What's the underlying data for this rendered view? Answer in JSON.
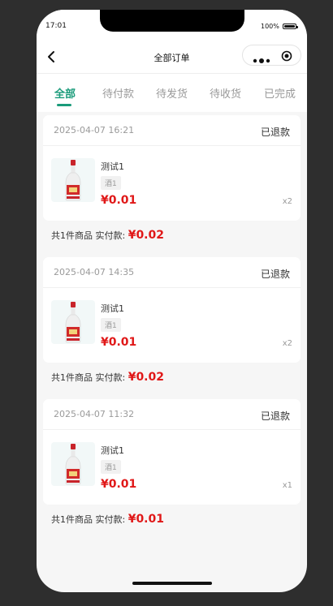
{
  "status_bar": {
    "time": "17:01",
    "battery": "100%"
  },
  "nav": {
    "title": "全部订单"
  },
  "tabs": [
    {
      "label": "全部",
      "active": true
    },
    {
      "label": "待付款",
      "active": false
    },
    {
      "label": "待发货",
      "active": false
    },
    {
      "label": "待收货",
      "active": false
    },
    {
      "label": "已完成",
      "active": false
    }
  ],
  "orders": [
    {
      "date": "2025-04-07 16:21",
      "status": "已退款",
      "product": {
        "name": "测试1",
        "tag": "酒1",
        "price": "¥0.01",
        "qty": "x2"
      },
      "summary": {
        "label": "共1件商品 实付款:",
        "amount": "¥0.02"
      }
    },
    {
      "date": "2025-04-07 14:35",
      "status": "已退款",
      "product": {
        "name": "测试1",
        "tag": "酒1",
        "price": "¥0.01",
        "qty": "x2"
      },
      "summary": {
        "label": "共1件商品 实付款:",
        "amount": "¥0.02"
      }
    },
    {
      "date": "2025-04-07 11:32",
      "status": "已退款",
      "product": {
        "name": "测试1",
        "tag": "酒1",
        "price": "¥0.01",
        "qty": "x1"
      },
      "summary": {
        "label": "共1件商品 实付款:",
        "amount": "¥0.01"
      }
    }
  ],
  "colors": {
    "accent": "#1a9b7a",
    "price": "#e01818",
    "background": "#2e2e2e",
    "surface": "#f6f6f6"
  },
  "icons": {
    "back": "chevron-left-icon",
    "more": "more-dots-icon",
    "close": "target-icon",
    "product": "liquor-bottle-icon"
  }
}
